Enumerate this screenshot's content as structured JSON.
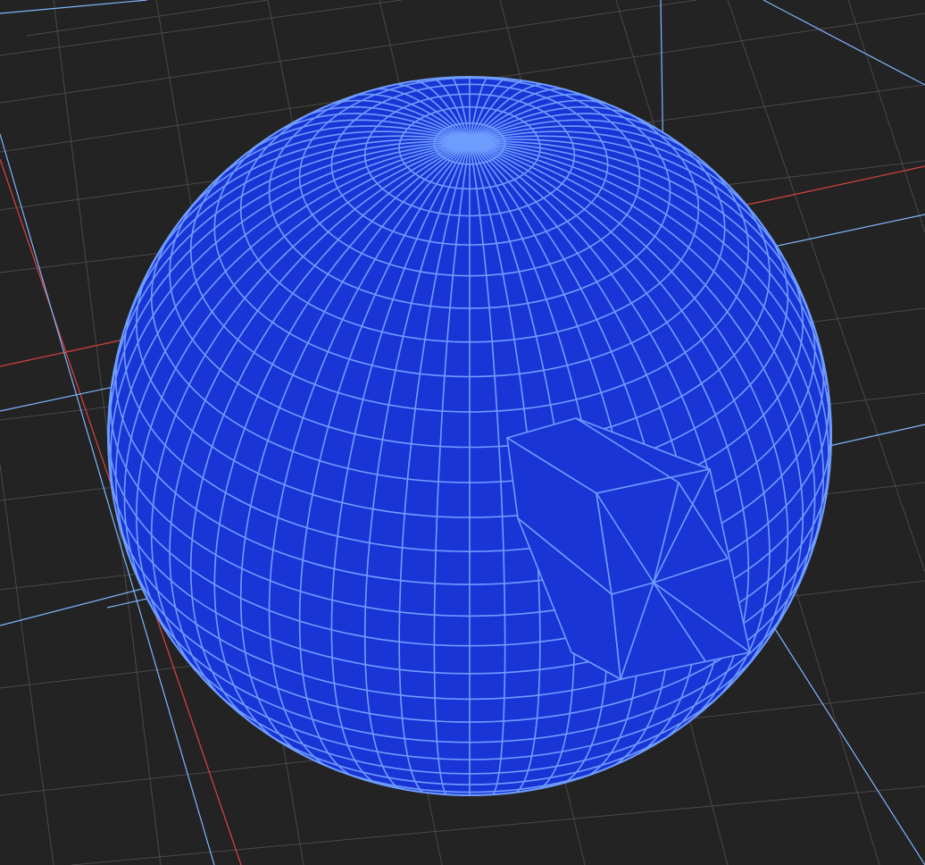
{
  "viewport": {
    "background": "#232323",
    "grid_color": "#5a5a5a",
    "x_axis_color": "#d04040",
    "selection_outline_color": "#7fb6ff"
  },
  "mesh": {
    "object_type": "uv-sphere",
    "fill_color": "#1a35d6",
    "wire_color": "#6f9dff",
    "nub_type": "extruded-box"
  }
}
